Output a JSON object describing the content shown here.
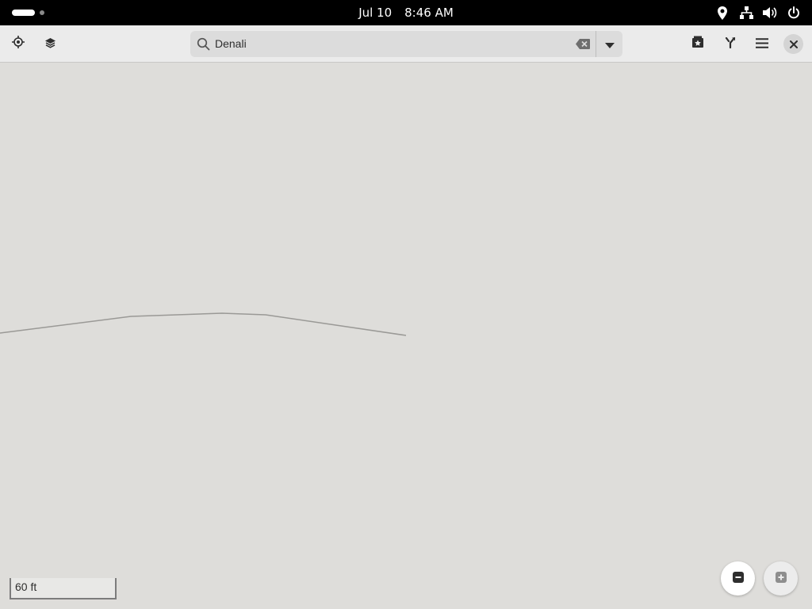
{
  "topbar": {
    "date": "Jul 10",
    "time": "8:46 AM",
    "tray_icons": [
      "location-icon",
      "network-icon",
      "volume-icon",
      "power-icon"
    ]
  },
  "headerbar": {
    "left_buttons": [
      "gps-locate-icon",
      "layers-icon"
    ],
    "search": {
      "value": "Denali",
      "placeholder": "Search"
    },
    "right_buttons": [
      "favorites-icon",
      "route-icon",
      "hamburger-menu-icon"
    ],
    "close_icon": "close-icon"
  },
  "map": {
    "scale_label": "60 ft",
    "zoom_out_icon": "minus-icon",
    "zoom_in_icon": "plus-icon",
    "background_color": "#deddda",
    "road_color": "#9a9996"
  }
}
